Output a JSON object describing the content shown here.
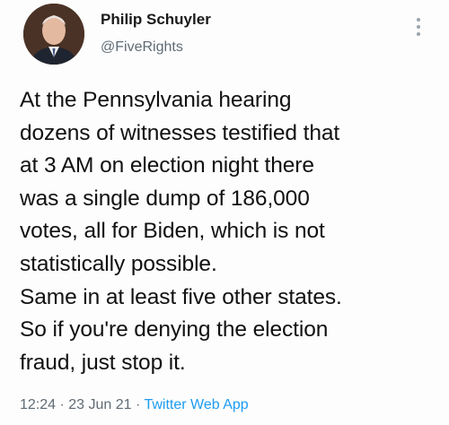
{
  "author": {
    "name": "Philip Schuyler",
    "handle": "@FiveRights"
  },
  "tweet": {
    "lines": [
      "At the Pennsylvania hearing",
      "dozens of witnesses testified that",
      "at 3 AM on election night there",
      "was a single dump of 186,000",
      "votes, all for Biden, which is not",
      "statistically possible.",
      "Same in at least five other states.",
      "So if you're denying the election",
      "fraud, just stop it."
    ]
  },
  "meta": {
    "time": "12:24",
    "separator": " · ",
    "date": "23 Jun 21",
    "app": "Twitter Web App"
  },
  "icons": {
    "more": "more-vertical-icon"
  },
  "colors": {
    "link": "#1d9bf0",
    "secondary_text": "#5f6b75"
  }
}
